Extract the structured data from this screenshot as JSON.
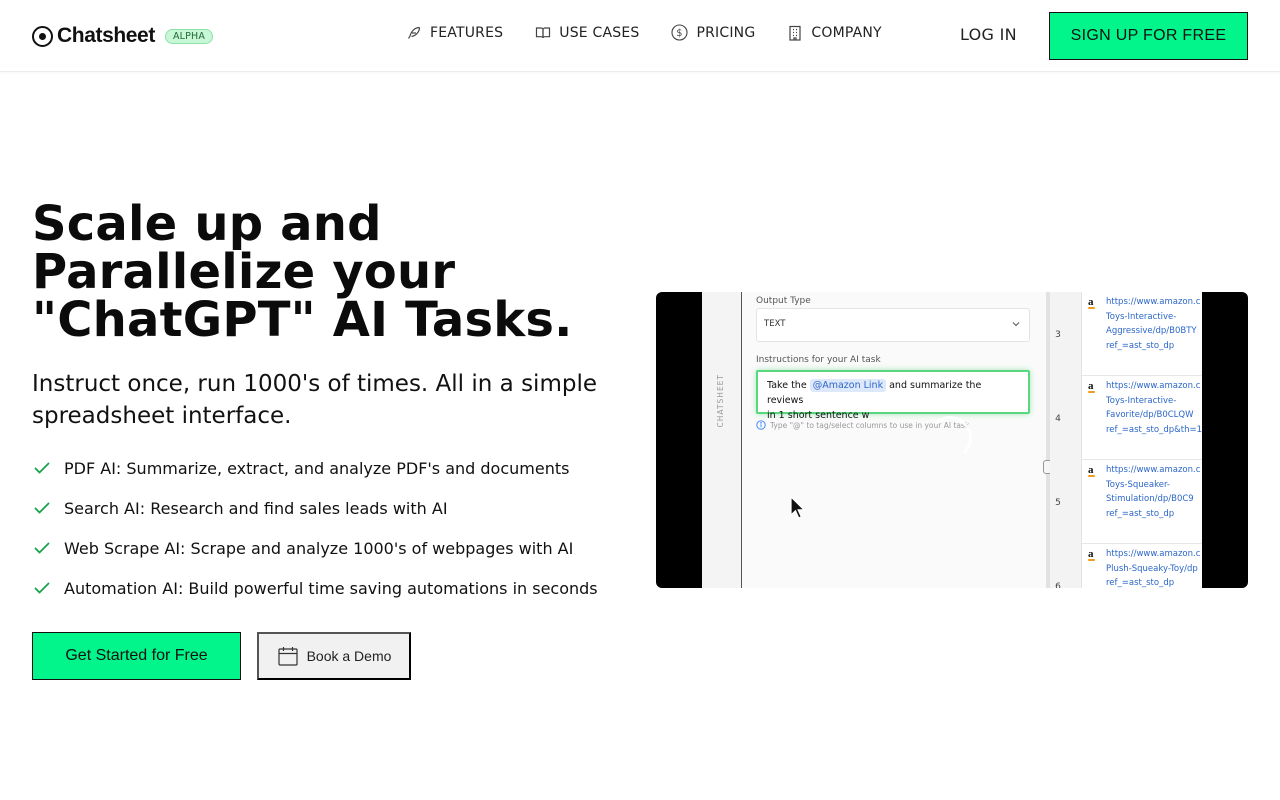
{
  "header": {
    "brand": "Chatsheet",
    "badge": "ALPHA",
    "nav": [
      {
        "label": "FEATURES",
        "icon": "feather-icon"
      },
      {
        "label": "USE CASES",
        "icon": "book-open-icon"
      },
      {
        "label": "PRICING",
        "icon": "dollar-circle-icon"
      },
      {
        "label": "COMPANY",
        "icon": "building-icon"
      }
    ],
    "login": "LOG IN",
    "signup": "SIGN UP FOR FREE"
  },
  "hero": {
    "headline": "Scale up and Parallelize your \"ChatGPT\" AI Tasks.",
    "subtitle": "Instruct once, run 1000's of times. All in a simple spreadsheet interface.",
    "features": [
      "PDF AI: Summarize, extract, and analyze PDF's and documents",
      "Search AI: Research and find sales leads with AI",
      "Web Scrape AI: Scrape and analyze 1000's of webpages with AI",
      "Automation AI: Build powerful time saving automations in seconds"
    ],
    "cta_primary": "Get Started for Free",
    "cta_secondary": "Book a Demo"
  },
  "video": {
    "side_label": "CHATSHEET",
    "output_type_label": "Output Type",
    "output_type_value": "TEXT",
    "instructions_label": "Instructions for your AI task",
    "instruction_before": "Take the",
    "instruction_tag": "@Amazon Link",
    "instruction_after": "and summarize the reviews",
    "instruction_line2": "in 1 short sentence w",
    "hint": "Type \"@\" to tag/select columns to use in your AI task",
    "rows": [
      {
        "num": "3",
        "url": "https://www.amazon.c\nToys-Interactive-\nAggressive/dp/B0BTY\nref_=ast_sto_dp"
      },
      {
        "num": "4",
        "url": "https://www.amazon.c\nToys-Interactive-\nFavorite/dp/B0CLQW\nref_=ast_sto_dp&th=1"
      },
      {
        "num": "5",
        "url": "https://www.amazon.c\nToys-Squeaker-\nStimulation/dp/B0C9\nref_=ast_sto_dp"
      },
      {
        "num": "6",
        "url": "https://www.amazon.c\nPlush-Squeaky-Toy/dp\nref_=ast_sto_dp"
      }
    ]
  },
  "colors": {
    "accent": "#02f58b",
    "badge_bg": "#c8f7d7",
    "check": "#16a34a",
    "link": "#2b66c9",
    "focus_ring": "#58d77e"
  }
}
